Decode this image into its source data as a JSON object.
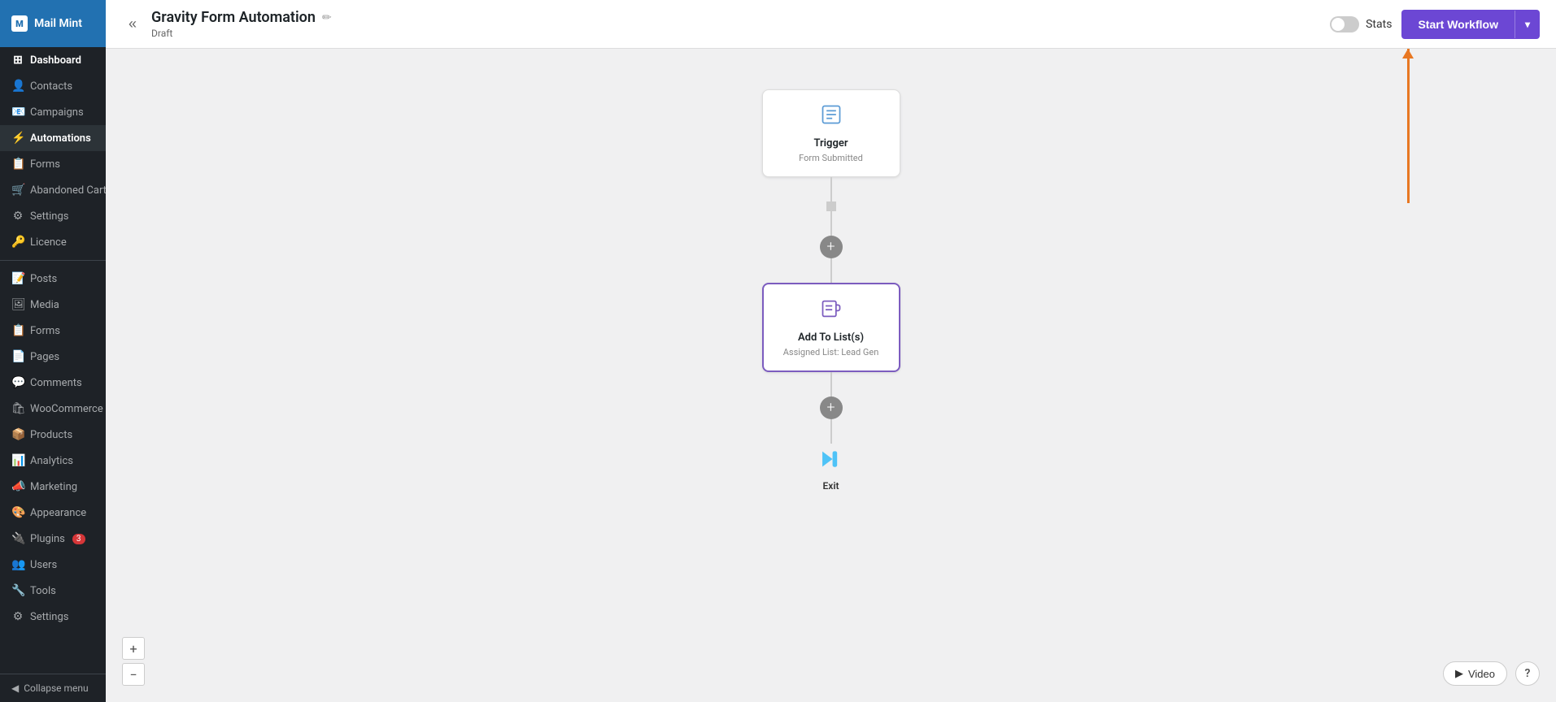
{
  "sidebar": {
    "brand": "Mail Mint",
    "brand_icon": "M",
    "items_top": [
      {
        "id": "dashboard",
        "label": "Dashboard",
        "icon": "⊞"
      },
      {
        "id": "contacts",
        "label": "Contacts",
        "icon": "👤"
      },
      {
        "id": "campaigns",
        "label": "Campaigns",
        "icon": "📧"
      },
      {
        "id": "automations",
        "label": "Automations",
        "icon": "",
        "bold": true
      },
      {
        "id": "forms",
        "label": "Forms",
        "icon": ""
      },
      {
        "id": "abandoned-cart",
        "label": "Abandoned Cart",
        "icon": ""
      },
      {
        "id": "settings",
        "label": "Settings",
        "icon": ""
      },
      {
        "id": "licence",
        "label": "Licence",
        "icon": ""
      }
    ],
    "items_wp": [
      {
        "id": "posts",
        "label": "Posts",
        "icon": "📝"
      },
      {
        "id": "media",
        "label": "Media",
        "icon": "🖼"
      },
      {
        "id": "forms",
        "label": "Forms",
        "icon": "📋"
      },
      {
        "id": "pages",
        "label": "Pages",
        "icon": "📄"
      },
      {
        "id": "comments",
        "label": "Comments",
        "icon": "💬"
      },
      {
        "id": "woocommerce",
        "label": "WooCommerce",
        "icon": "🛒"
      },
      {
        "id": "products",
        "label": "Products",
        "icon": "📦"
      },
      {
        "id": "analytics",
        "label": "Analytics",
        "icon": "📊"
      },
      {
        "id": "marketing",
        "label": "Marketing",
        "icon": "📣"
      },
      {
        "id": "appearance",
        "label": "Appearance",
        "icon": "🎨"
      },
      {
        "id": "plugins",
        "label": "Plugins",
        "icon": "🔌",
        "badge": "3"
      },
      {
        "id": "users",
        "label": "Users",
        "icon": "👥"
      },
      {
        "id": "tools",
        "label": "Tools",
        "icon": "🔧"
      },
      {
        "id": "settings-wp",
        "label": "Settings",
        "icon": "⚙"
      }
    ],
    "collapse_label": "Collapse menu"
  },
  "topbar": {
    "title": "Gravity Form Automation",
    "status": "Draft",
    "stats_label": "Stats",
    "start_workflow_label": "Start Workflow",
    "dropdown_icon": "▾"
  },
  "workflow": {
    "trigger_node": {
      "title": "Trigger",
      "subtitle": "Form Submitted"
    },
    "action_node": {
      "title": "Add To List(s)",
      "subtitle": "Assigned List: Lead Gen"
    },
    "exit_node": {
      "label": "Exit"
    }
  },
  "canvas": {
    "zoom_in_label": "+",
    "zoom_out_label": "−",
    "video_label": "Video",
    "help_label": "?"
  }
}
